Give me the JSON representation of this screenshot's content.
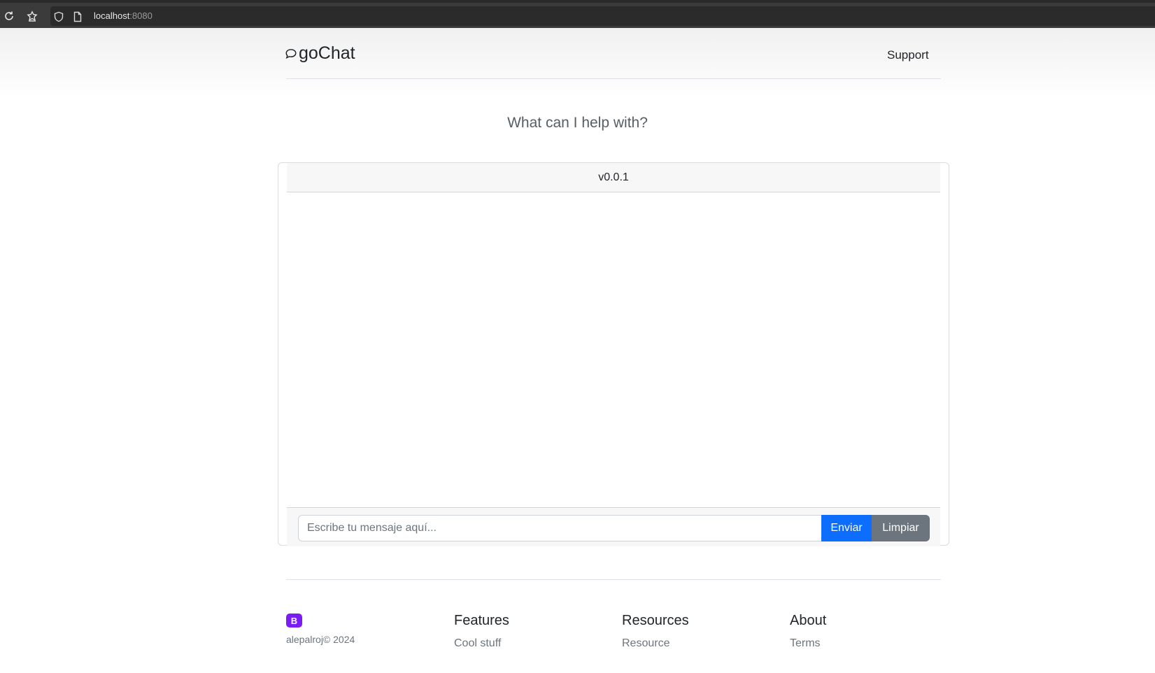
{
  "browser": {
    "url_host": "localhost",
    "url_port": ":8080"
  },
  "header": {
    "brand": "goChat",
    "nav_support": "Support"
  },
  "main": {
    "headline": "What can I help with?"
  },
  "chat": {
    "version": "v0.0.1",
    "input_placeholder": "Escribe tu mensaje aquí...",
    "send_label": "Enviar",
    "clear_label": "Limpiar"
  },
  "footer": {
    "logo_letter": "B",
    "copyright": "alepalroj© 2024",
    "columns": [
      {
        "title": "Features",
        "link": "Cool stuff"
      },
      {
        "title": "Resources",
        "link": "Resource"
      },
      {
        "title": "About",
        "link": "Terms"
      }
    ]
  },
  "colors": {
    "primary": "#0d6efd",
    "secondary": "#6c757d",
    "bootstrap_purple": "#7a1cf4"
  }
}
